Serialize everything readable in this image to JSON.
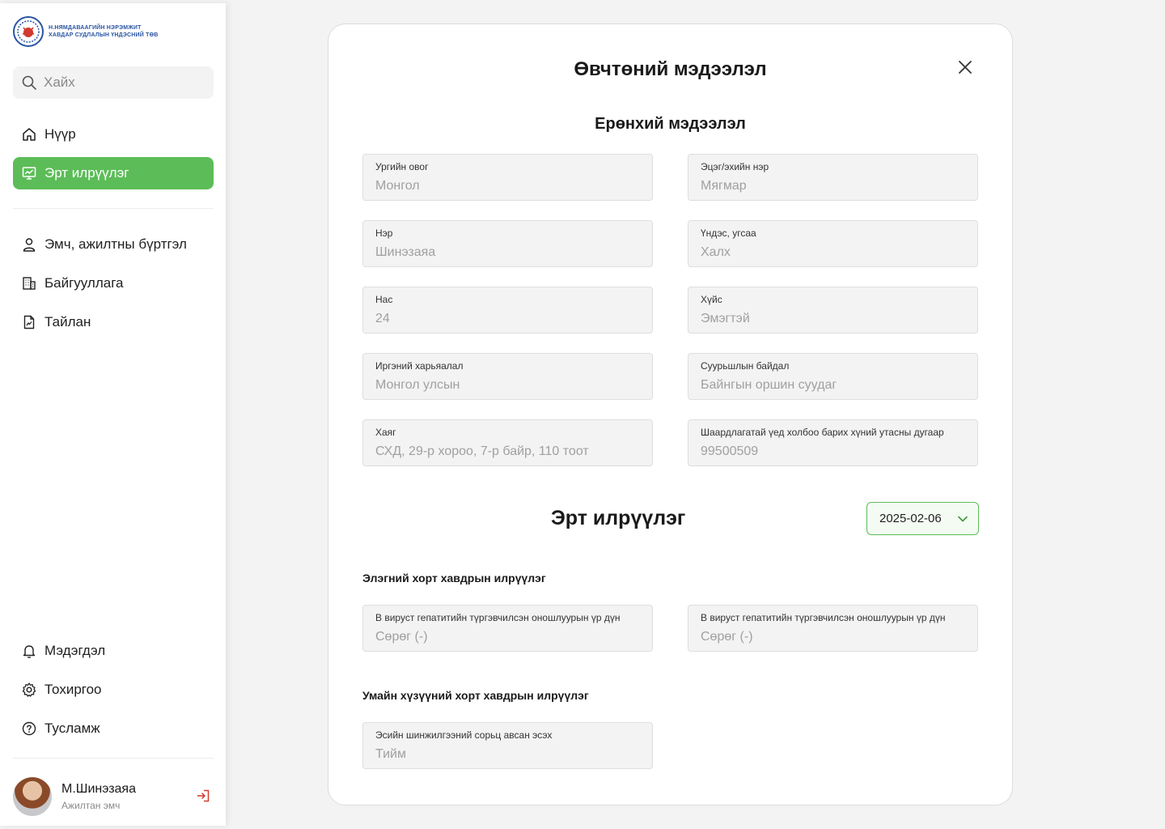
{
  "brand": {
    "line1": "Н.НЯМДАВААГИЙН НЭРЭМЖИТ",
    "line2": "ХАВДАР СУДЛАЛЫН ҮНДЭСНИЙ ТӨВ"
  },
  "search": {
    "placeholder": "Хайх"
  },
  "nav": {
    "home": "Нүүр",
    "early": "Эрт илрүүлэг",
    "staff": "Эмч, ажилтны бүртгэл",
    "org": "Байгууллага",
    "report": "Тайлан",
    "notifications": "Мэдэгдэл",
    "settings": "Тохиргоо",
    "help": "Тусламж"
  },
  "user": {
    "name": "М.Шинэзаяа",
    "role": "Ажилтан эмч"
  },
  "modal": {
    "title": "Өвчтөний мэдээлэл",
    "general_title": "Ерөнхий мэдээлэл",
    "fields": [
      {
        "label": "Ургийн овог",
        "value": "Монгол"
      },
      {
        "label": "Эцэг/эхийн нэр",
        "value": "Мягмар"
      },
      {
        "label": "Нэр",
        "value": "Шинэзаяа"
      },
      {
        "label": "Үндэс, угсаа",
        "value": "Халх"
      },
      {
        "label": "Нас",
        "value": "24"
      },
      {
        "label": "Хүйс",
        "value": "Эмэгтэй"
      },
      {
        "label": "Иргэний харьяалал",
        "value": "Монгол улсын"
      },
      {
        "label": "Суурьшлын байдал",
        "value": "Байнгын оршин суудаг"
      },
      {
        "label": "Хаяг",
        "value": "СХД, 29-р хороо, 7-р байр, 110 тоот"
      },
      {
        "label": "Шаардлагатай үед холбоо барих хүний утасны дугаар",
        "value": "99500509"
      }
    ],
    "early_title": "Эрт илрүүлэг",
    "date": "2025-02-06",
    "liver_title": "Элэгний хорт хавдрын илрүүлэг",
    "liver_fields": [
      {
        "label": "В вируст гепатитийн түргэвчилсэн оношлуурын үр дүн",
        "value": "Сөрөг (-)"
      },
      {
        "label": "В вируст гепатитийн түргэвчилсэн оношлуурын үр дүн",
        "value": "Сөрөг (-)"
      }
    ],
    "cervical_title": "Умайн хүзүүний хорт хавдрын илрүүлэг",
    "cervical_fields": [
      {
        "label": "Эсийн шинжилгээний сорьц авсан эсэх",
        "value": "Тийм"
      }
    ]
  }
}
